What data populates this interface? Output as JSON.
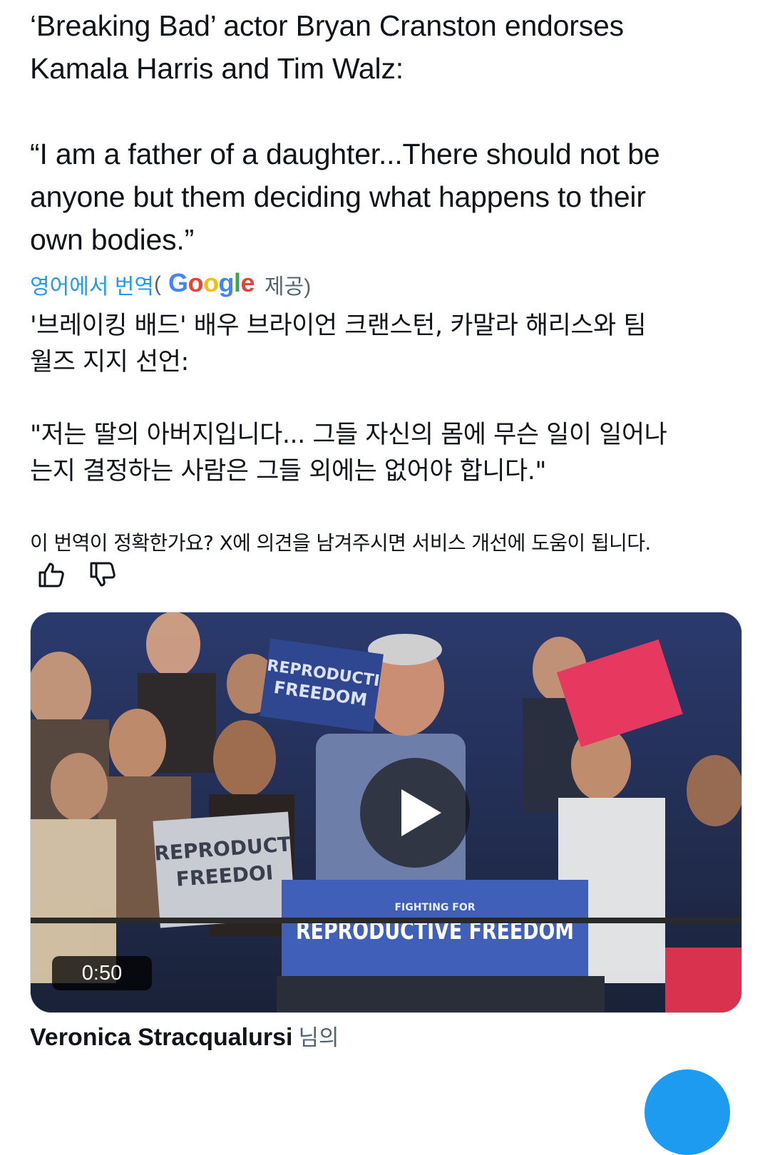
{
  "post": {
    "lines": [
      "‘Breaking Bad’ actor Bryan Cranston endorses",
      "Kamala Harris and Tim Walz:",
      "“I am a father of a daughter...There should not be",
      "anyone but them deciding what happens to their",
      "own bodies.”"
    ]
  },
  "translation": {
    "link_label": "영어에서 번역",
    "open_paren": "(",
    "provider_letters": [
      "G",
      "o",
      "o",
      "g",
      "l",
      "e"
    ],
    "provided_label": "제공)",
    "lines": [
      "'브레이킹 배드' 배우 브라이언 크랜스턴, 카말라 해리스와 팀",
      "월즈 지지 선언:",
      "\"저는 딸의 아버지입니다... 그들 자신의 몸에 무슨 일이 일어나",
      "는지 결정하는 사람은 그들 외에는 없어야 합니다.\""
    ],
    "feedback_question": "이 번역이 정확한가요? X에 의견을 남겨주시면 서비스 개선에 도움이 됩니다."
  },
  "media": {
    "duration": "0:50",
    "sign_texts": {
      "podium_small": "FIGHTING FOR",
      "podium_large": "REPRODUCTIVE FREEDOM",
      "left_sign_line1": "REPRODUCT",
      "left_sign_line2": "FREEDOI",
      "back_sign_line1": "REPRODUCTI",
      "back_sign_line2": "FREEDOM"
    }
  },
  "attribution": {
    "name": "Veronica Stracqualursi",
    "suffix": "님의"
  },
  "colors": {
    "accent": "#1d9bf0",
    "text": "#0f1419",
    "muted": "#536471",
    "podium_blue": "#3f5fb8"
  }
}
